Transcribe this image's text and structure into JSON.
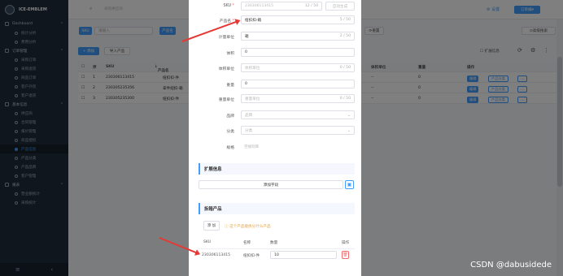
{
  "app": {
    "name": "ICE-EMBLEM"
  },
  "sidebar": {
    "items": [
      {
        "label": "Dashboard",
        "type": "group"
      },
      {
        "label": "统计分析",
        "type": "child"
      },
      {
        "label": "费用分析",
        "type": "child"
      },
      {
        "label": "订单管理",
        "type": "group"
      },
      {
        "label": "采购订单",
        "type": "child"
      },
      {
        "label": "采购退货",
        "type": "child"
      },
      {
        "label": "商品订单",
        "type": "child"
      },
      {
        "label": "客户外贸",
        "type": "child"
      },
      {
        "label": "客户退货",
        "type": "child"
      },
      {
        "label": "基本信息",
        "type": "group"
      },
      {
        "label": "供应商",
        "type": "child"
      },
      {
        "label": "合同管理",
        "type": "child"
      },
      {
        "label": "报价管理",
        "type": "child"
      },
      {
        "label": "商品授权",
        "type": "child"
      },
      {
        "label": "产品信息",
        "type": "child",
        "active": true
      },
      {
        "label": "产品分类",
        "type": "child"
      },
      {
        "label": "产品品牌",
        "type": "child"
      },
      {
        "label": "客户管理",
        "type": "child"
      },
      {
        "label": "报表",
        "type": "group"
      },
      {
        "label": "营业额统计",
        "type": "child"
      },
      {
        "label": "采购统计",
        "type": "child"
      }
    ]
  },
  "topbar": {
    "search_placeholder": "采购供应商",
    "settings_label": "设置",
    "user_label": "订单编"
  },
  "filters": {
    "sku_tag": "SKU",
    "name_placeholder": "请输入",
    "category_tag": "产品名",
    "reset_label": "重置",
    "advanced_label": "高级搜索"
  },
  "toolbar": {
    "add_label": "+ 添加",
    "import_label": "导入产品",
    "column_label": "扩展信息"
  },
  "table": {
    "headers": {
      "idx": "序",
      "sku": "SKU",
      "name": "产品名",
      "extra_unit": "体积单位",
      "weight": "重量",
      "ops": "操作"
    },
    "rows": [
      {
        "idx": "1",
        "sku": "230306113415",
        "name": "纽扣扣-件",
        "unit": "--",
        "weight": "0"
      },
      {
        "idx": "2",
        "sku": "230305235356",
        "name": "拿件纽扣-箱",
        "unit": "--",
        "weight": "0"
      },
      {
        "idx": "3",
        "sku": "230305235300",
        "name": "纽扣扣-件",
        "unit": "--",
        "weight": "0"
      }
    ],
    "op_edit": "编辑",
    "op_product": "产品分类"
  },
  "modal": {
    "fields": {
      "sku": {
        "label": "SKU",
        "placeholder": "230306113415",
        "count": "12 / 50",
        "btn": "自动生成"
      },
      "name": {
        "label": "产品名",
        "value": "纽扣扣-箱",
        "count": "5 / 50"
      },
      "unit": {
        "label": "计量单位",
        "value": "箱",
        "count": "2 / 50"
      },
      "volume": {
        "label": "体积",
        "value": "0"
      },
      "volume_unit": {
        "label": "体积单位",
        "placeholder": "体积单位",
        "count": "0 / 50"
      },
      "weight": {
        "label": "重量",
        "value": "0"
      },
      "weight_unit": {
        "label": "重量单位",
        "placeholder": "重量单位",
        "count": "0 / 50"
      },
      "brand": {
        "label": "品牌",
        "placeholder": "品牌"
      },
      "category": {
        "label": "分类",
        "placeholder": "分类"
      },
      "spec": {
        "label": "规格",
        "placeholder": "空规则率"
      }
    },
    "ext_section": {
      "title": "扩展信息",
      "add_label": "添加字段"
    },
    "split_section": {
      "title": "拆箱产品",
      "add_label": "添 加",
      "hint": "这个产品能拆分什么产品",
      "headers": {
        "sku": "SKU",
        "name": "名称",
        "qty": "数量",
        "op": "操作"
      },
      "row": {
        "sku": "230306113415",
        "name": "纽扣扣-件",
        "qty": "10"
      }
    }
  },
  "watermark": "CSDN @dabusidede",
  "colors": {
    "accent": "#409eff",
    "sidebar": "#1f2d3d",
    "arrow": "#e53935",
    "danger": "#f56c6c"
  }
}
